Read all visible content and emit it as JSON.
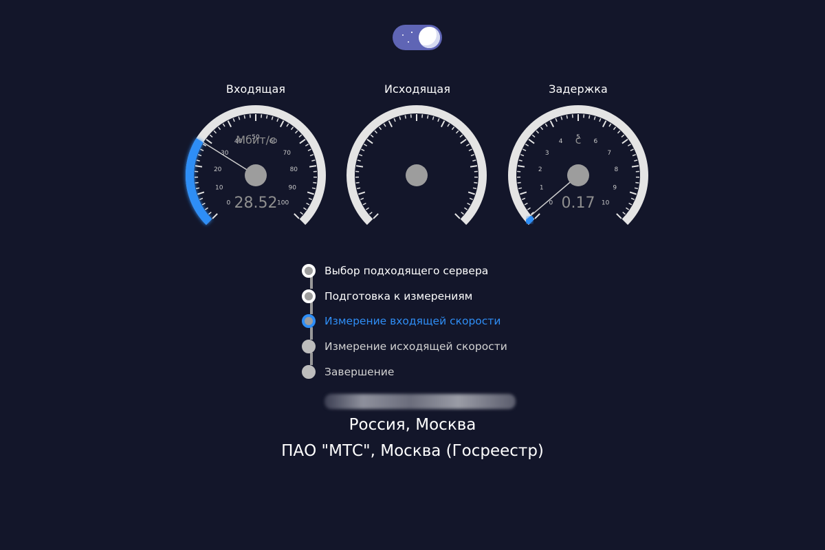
{
  "gauges": [
    {
      "id": "incoming",
      "title": "Входящая",
      "unit": "Мбит/с",
      "value_text": "28.52",
      "value": 28.52,
      "min": 0,
      "max": 100,
      "ticks": [
        "0",
        "10",
        "20",
        "30",
        "40",
        "50",
        "60",
        "70",
        "80",
        "90",
        "100"
      ]
    },
    {
      "id": "outgoing",
      "title": "Исходящая",
      "unit": "",
      "value_text": "",
      "value": 0,
      "min": 0,
      "max": 100,
      "ticks": []
    },
    {
      "id": "latency",
      "title": "Задержка",
      "unit": "с",
      "value_text": "0.17",
      "value": 0.17,
      "min": 0,
      "max": 10,
      "ticks": [
        "0",
        "1",
        "2",
        "3",
        "4",
        "5",
        "6",
        "7",
        "8",
        "9",
        "10"
      ]
    }
  ],
  "steps": [
    {
      "label": "Выбор подходящего сервера",
      "state": "done"
    },
    {
      "label": "Подготовка к измерениям",
      "state": "done"
    },
    {
      "label": "Измерение входящей скорости",
      "state": "active"
    },
    {
      "label": "Измерение исходящей скорости",
      "state": "pending"
    },
    {
      "label": "Завершение",
      "state": "pending"
    }
  ],
  "location": {
    "city": "Россия, Москва",
    "provider": "ПАО \"МТС\", Москва (Госреестр)"
  },
  "colors": {
    "background": "#13162a",
    "accent": "#2f8ef6",
    "arc": "#e4e4e4",
    "hub": "#9d9d9d",
    "toggle": "#5f65b5"
  },
  "icons": {
    "theme_toggle": "night-mode-toggle-icon"
  }
}
